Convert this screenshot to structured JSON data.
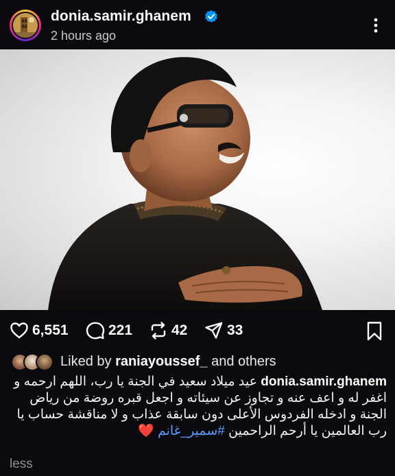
{
  "post": {
    "username": "donia.samir.ghanem",
    "timestamp": "2 hours ago",
    "verified": true
  },
  "actions": {
    "likes": "6,551",
    "comments": "221",
    "reposts": "42",
    "shares": "33"
  },
  "liked_by": {
    "prefix": "Liked by ",
    "user": "raniayoussef_",
    "suffix": " and others"
  },
  "caption": {
    "user": "donia.samir.ghanem",
    "text": "عيد ميلاد سعيد في الجنة يا رب، اللهم ارحمه و اغفر له و اعف عنه و تجاوز عن سيئاته و اجعل قبره روضة من رياض الجنة و ادخله الفردوس الأعلى دون سابقة عذاب و لا مناقشة حساب يا رب العالمين يا أرحم الراحمين",
    "hashtag": "#سمير_غانم",
    "heart": "❤️",
    "less_label": "less"
  },
  "icons": {
    "verified": "verified-badge-icon",
    "more": "more-vertical-icon",
    "like": "heart-icon",
    "comment": "comment-bubble-icon",
    "repost": "repost-icon",
    "share": "paper-plane-icon",
    "bookmark": "bookmark-icon"
  },
  "colors": {
    "background": "#0b0b0f",
    "verified_blue": "#0095f6",
    "hashtag_blue": "#5b9cff",
    "heart_red": "#e0245e"
  }
}
